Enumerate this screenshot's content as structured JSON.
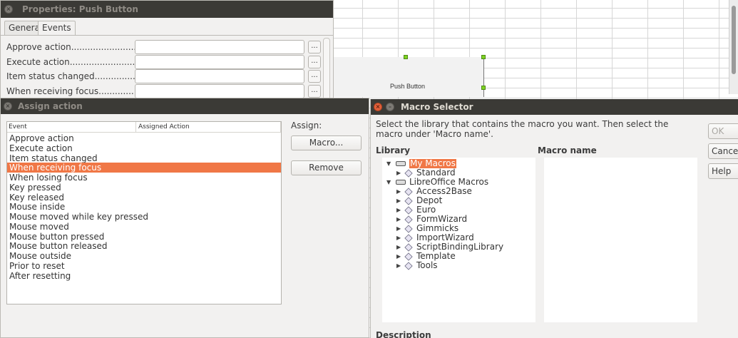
{
  "spreadsheet": {
    "push_button_label": "Push Button"
  },
  "properties_dialog": {
    "title": "Properties: Push Button",
    "tabs": [
      {
        "label": "General"
      },
      {
        "label": "Events"
      }
    ],
    "rows": [
      {
        "label": "Approve action.................................",
        "value": ""
      },
      {
        "label": "Execute action.................................",
        "value": ""
      },
      {
        "label": "Item status changed.......................",
        "value": ""
      },
      {
        "label": "When receiving focus....................",
        "value": ""
      }
    ],
    "dots_label": "..."
  },
  "assign_action_dialog": {
    "title": "Assign action",
    "columns": {
      "event": "Event",
      "assigned_action": "Assigned Action"
    },
    "events": [
      "Approve action",
      "Execute action",
      "Item status changed",
      "When receiving focus",
      "When losing focus",
      "Key pressed",
      "Key released",
      "Mouse inside",
      "Mouse moved while key pressed",
      "Mouse moved",
      "Mouse button pressed",
      "Mouse button released",
      "Mouse outside",
      "Prior to reset",
      "After resetting"
    ],
    "selected_event": "When receiving focus",
    "assign_label": "Assign:",
    "macro_button": "Macro...",
    "remove_button": "Remove"
  },
  "macro_selector": {
    "title": "Macro Selector",
    "instructions": "Select the library that contains the macro you want. Then select the macro under 'Macro name'.",
    "library_header": "Library",
    "macro_name_header": "Macro name",
    "description_header": "Description",
    "library_tree": {
      "my_macros": {
        "label": "My Macros",
        "children": [
          "Standard"
        ]
      },
      "libreoffice_macros": {
        "label": "LibreOffice Macros",
        "children": [
          "Access2Base",
          "Depot",
          "Euro",
          "FormWizard",
          "Gimmicks",
          "ImportWizard",
          "ScriptBindingLibrary",
          "Template",
          "Tools"
        ]
      }
    },
    "buttons": {
      "ok": "OK",
      "cancel": "Cancel",
      "help": "Help"
    }
  },
  "colors": {
    "selection": "#f07746",
    "titlebar": "#3b3a36",
    "handle": "#7ed321"
  }
}
